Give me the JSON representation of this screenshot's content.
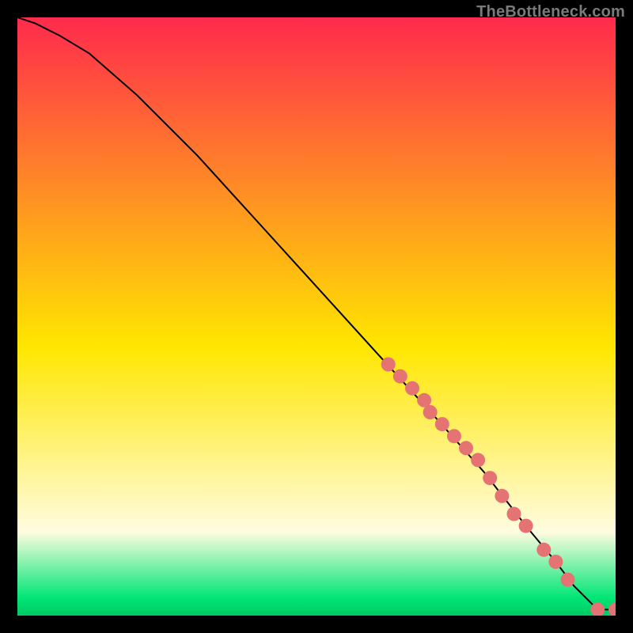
{
  "watermark": "TheBottleneck.com",
  "colors": {
    "top": "#ff2a4d",
    "mid": "#ffe600",
    "cream": "#fffce0",
    "green": "#00e676",
    "curve": "#000000",
    "dots": "#e57373"
  },
  "chart_data": {
    "type": "line",
    "title": "",
    "xlabel": "",
    "ylabel": "",
    "xlim": [
      0,
      100
    ],
    "ylim": [
      0,
      100
    ],
    "series": [
      {
        "name": "bottleneck-curve",
        "x": [
          0,
          3,
          7,
          12,
          20,
          30,
          40,
          50,
          60,
          70,
          78,
          85,
          90,
          93,
          95,
          97,
          100
        ],
        "values": [
          100,
          99,
          97,
          94,
          87,
          77,
          66,
          55,
          44,
          33,
          24,
          15,
          9,
          5,
          3,
          1,
          1
        ]
      }
    ],
    "highlight_dots": {
      "name": "sample-points",
      "x": [
        62,
        64,
        66,
        68,
        69,
        71,
        73,
        75,
        77,
        79,
        81,
        83,
        85,
        88,
        90,
        92,
        97,
        100
      ],
      "values": [
        42,
        40,
        38,
        36,
        34,
        32,
        30,
        28,
        26,
        23,
        20,
        17,
        15,
        11,
        9,
        6,
        1,
        1
      ]
    }
  }
}
